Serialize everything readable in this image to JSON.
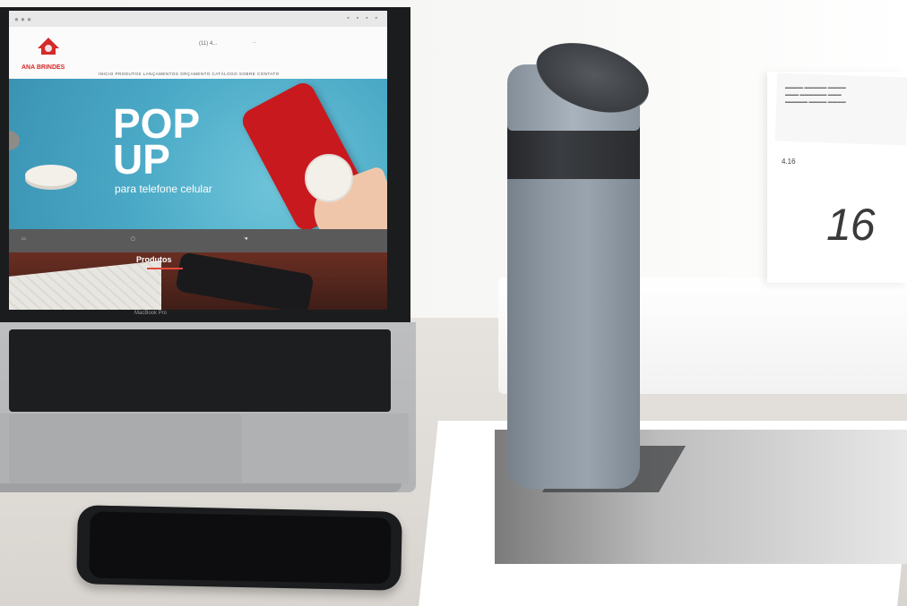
{
  "laptop": {
    "model_label": "MacBook Pro",
    "screen": {
      "header": {
        "logo_text": "ANA BRINDES",
        "phone": "(11) 4...",
        "contact_lines": "..."
      },
      "nav": "INICIO   PRODUTOS   LANÇAMENTOS   ORÇAMENTO   CATÁLOGO   SOBRE   CONTATO",
      "hero": {
        "title_line1": "POP",
        "title_line2": "UP",
        "subtitle": "para telefone celular"
      },
      "products_heading": "Produtos"
    }
  },
  "calendar": {
    "small_text": "4.16",
    "day_number": "16"
  },
  "colors": {
    "hero_blue": "#4aa9c6",
    "phone_red": "#c8191f",
    "bottle_gray": "#8d97a1",
    "bottle_band": "#2a2c2f"
  }
}
